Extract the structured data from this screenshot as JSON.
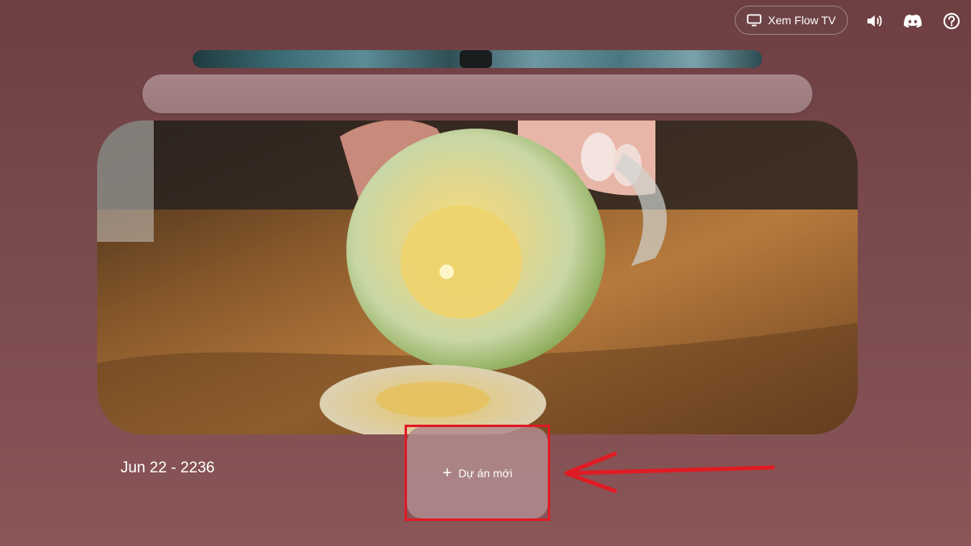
{
  "header": {
    "flow_tv_label": "Xem Flow TV",
    "icons": [
      "monitor-icon",
      "volume-icon",
      "discord-icon",
      "help-icon"
    ]
  },
  "project": {
    "date_label": "Jun 22 - 2236",
    "new_project_label": "Dự án mới"
  },
  "colors": {
    "background": "#7a4a4d",
    "annotation": "#e01b24"
  }
}
